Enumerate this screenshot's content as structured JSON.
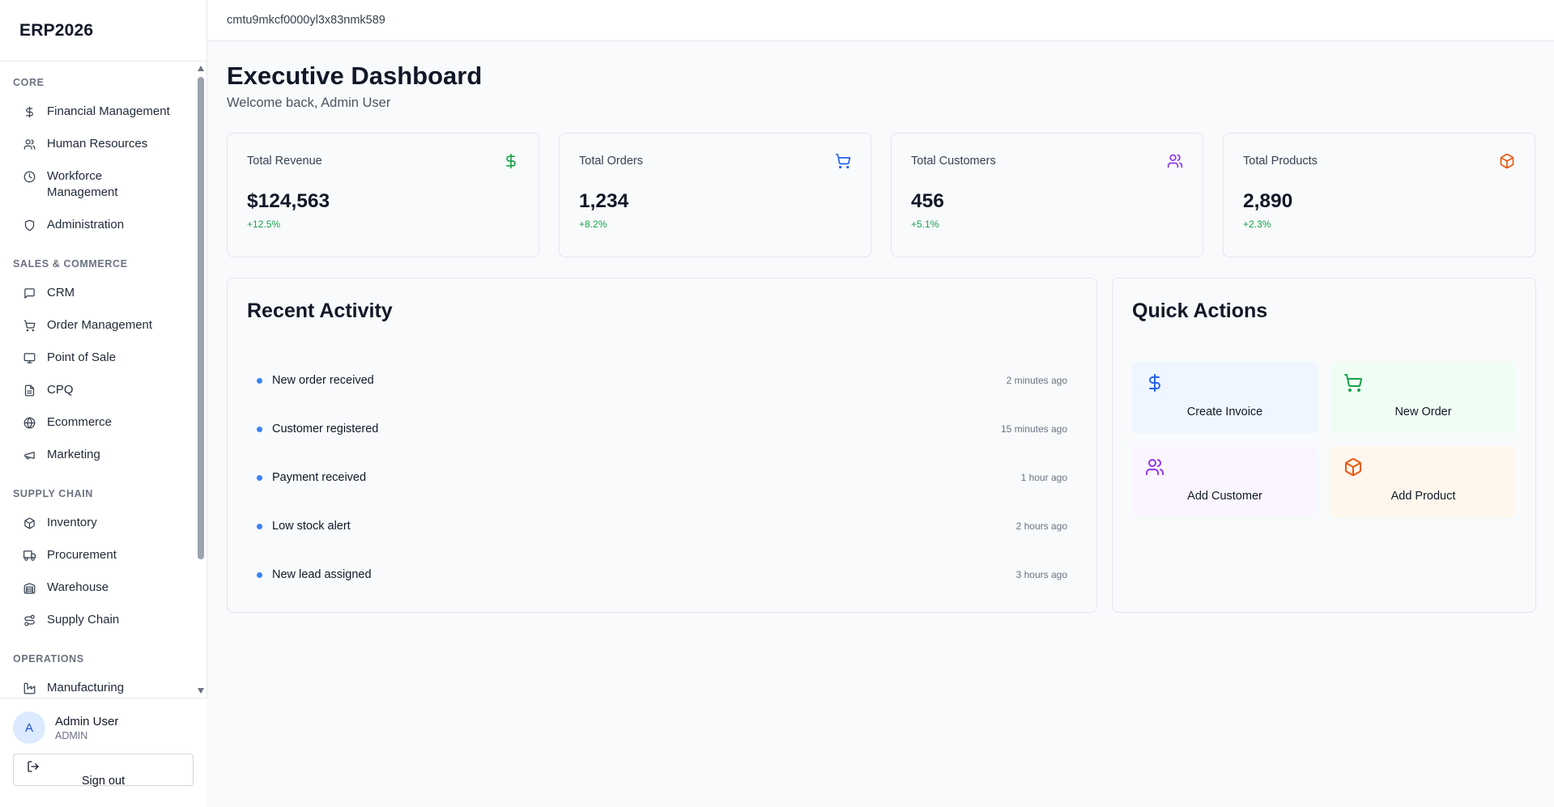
{
  "app": {
    "brand": "ERP2026",
    "record_id": "cmtu9mkcf0000yl3x83nmk589"
  },
  "sidebar": {
    "sections": [
      {
        "title": "CORE",
        "items": [
          {
            "label": "Financial Management",
            "icon": "dollar-icon"
          },
          {
            "label": "Human Resources",
            "icon": "users-icon"
          },
          {
            "label": "Workforce Management",
            "icon": "clock-icon"
          },
          {
            "label": "Administration",
            "icon": "shield-icon"
          }
        ]
      },
      {
        "title": "SALES & COMMERCE",
        "items": [
          {
            "label": "CRM",
            "icon": "chat-icon"
          },
          {
            "label": "Order Management",
            "icon": "cart-icon"
          },
          {
            "label": "Point of Sale",
            "icon": "monitor-icon"
          },
          {
            "label": "CPQ",
            "icon": "document-icon"
          },
          {
            "label": "Ecommerce",
            "icon": "globe-icon"
          },
          {
            "label": "Marketing",
            "icon": "megaphone-icon"
          }
        ]
      },
      {
        "title": "SUPPLY CHAIN",
        "items": [
          {
            "label": "Inventory",
            "icon": "package-icon"
          },
          {
            "label": "Procurement",
            "icon": "truck-icon"
          },
          {
            "label": "Warehouse",
            "icon": "warehouse-icon"
          },
          {
            "label": "Supply Chain",
            "icon": "route-icon"
          }
        ]
      },
      {
        "title": "OPERATIONS",
        "items": [
          {
            "label": "Manufacturing",
            "icon": "factory-icon"
          }
        ]
      }
    ]
  },
  "user": {
    "initial": "A",
    "name": "Admin User",
    "role": "ADMIN",
    "signout_label": "Sign out"
  },
  "header": {
    "title": "Executive Dashboard",
    "subtitle": "Welcome back, Admin User"
  },
  "stats": [
    {
      "label": "Total Revenue",
      "value": "$124,563",
      "change": "+12.5%",
      "icon": "dollar-icon",
      "color": "#16a34a"
    },
    {
      "label": "Total Orders",
      "value": "1,234",
      "change": "+8.2%",
      "icon": "cart-icon",
      "color": "#2563eb"
    },
    {
      "label": "Total Customers",
      "value": "456",
      "change": "+5.1%",
      "icon": "users-icon",
      "color": "#9333ea"
    },
    {
      "label": "Total Products",
      "value": "2,890",
      "change": "+2.3%",
      "icon": "package-icon",
      "color": "#ea580c"
    }
  ],
  "activity": {
    "title": "Recent Activity",
    "items": [
      {
        "text": "New order received",
        "time": "2 minutes ago"
      },
      {
        "text": "Customer registered",
        "time": "15 minutes ago"
      },
      {
        "text": "Payment received",
        "time": "1 hour ago"
      },
      {
        "text": "Low stock alert",
        "time": "2 hours ago"
      },
      {
        "text": "New lead assigned",
        "time": "3 hours ago"
      }
    ]
  },
  "quick_actions": {
    "title": "Quick Actions",
    "items": [
      {
        "label": "Create Invoice",
        "icon": "dollar-icon",
        "color": "#2563eb",
        "bg": "#eff6ff"
      },
      {
        "label": "New Order",
        "icon": "cart-icon",
        "color": "#16a34a",
        "bg": "#f0fdf4"
      },
      {
        "label": "Add Customer",
        "icon": "users-icon",
        "color": "#9333ea",
        "bg": "#faf5ff"
      },
      {
        "label": "Add Product",
        "icon": "package-icon",
        "color": "#ea580c",
        "bg": "#fff7ed"
      }
    ]
  }
}
